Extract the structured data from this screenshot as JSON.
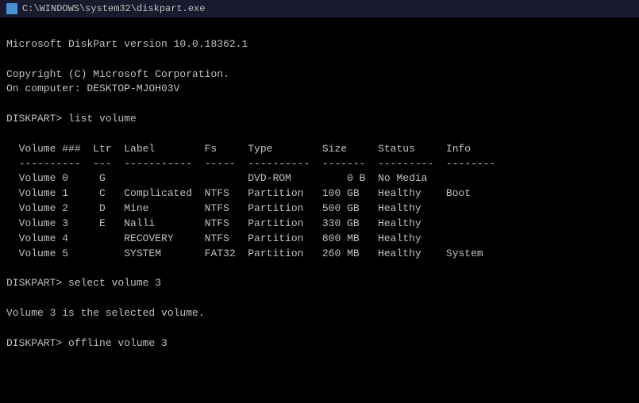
{
  "titleBar": {
    "icon": "cmd-icon",
    "title": "C:\\WINDOWS\\system32\\diskpart.exe"
  },
  "terminal": {
    "lines": [
      "",
      "Microsoft DiskPart version 10.0.18362.1",
      "",
      "Copyright (C) Microsoft Corporation.",
      "On computer: DESKTOP-MJOH03V",
      "",
      "DISKPART> list volume",
      "",
      "  Volume ###  Ltr  Label        Fs     Type        Size     Status     Info",
      "  ----------  ---  -----------  -----  ----------  -------  ---------  --------",
      "  Volume 0     G                       DVD-ROM         0 B  No Media",
      "  Volume 1     C   Complicated  NTFS   Partition   100 GB   Healthy    Boot",
      "  Volume 2     D   Mine         NTFS   Partition   500 GB   Healthy",
      "  Volume 3     E   Nalli        NTFS   Partition   330 GB   Healthy",
      "  Volume 4         RECOVERY     NTFS   Partition   800 MB   Healthy",
      "  Volume 5         SYSTEM       FAT32  Partition   260 MB   Healthy    System",
      "",
      "DISKPART> select volume 3",
      "",
      "Volume 3 is the selected volume.",
      "",
      "DISKPART> offline volume 3",
      ""
    ]
  }
}
